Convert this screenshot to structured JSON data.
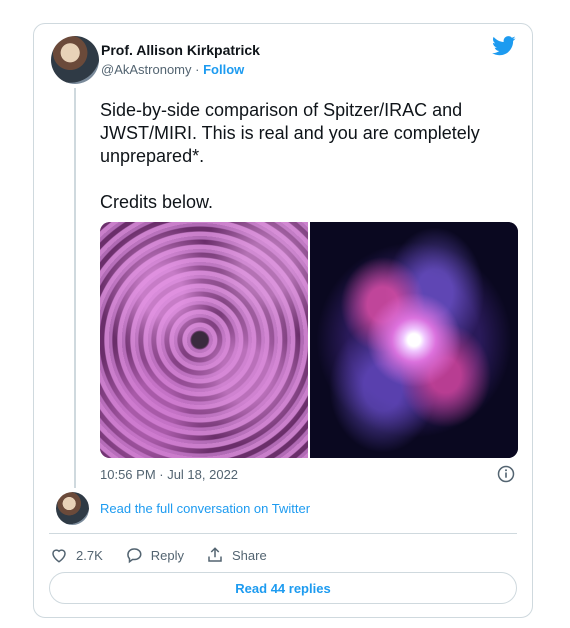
{
  "author": {
    "name": "Prof. Allison Kirkpatrick",
    "handle": "@AkAstronomy",
    "separator": "·",
    "follow_label": "Follow"
  },
  "tweet": {
    "text": "Side-by-side comparison of Spitzer/IRAC and JWST/MIRI. This is real and you are completely unprepared*.\n\nCredits below.",
    "timestamp": "10:56 PM · Jul 18, 2022"
  },
  "media": {
    "left_image": "jwst-miri-galaxy-image",
    "right_image": "spitzer-irac-galaxy-image"
  },
  "conversation_link": "Read the full conversation on Twitter",
  "actions": {
    "likes_count": "2.7K",
    "reply_label": "Reply",
    "share_label": "Share"
  },
  "read_replies_label": "Read 44 replies",
  "icons": {
    "brand": "twitter-bird-icon",
    "info": "info-icon",
    "like": "heart-icon",
    "reply": "reply-bubble-icon",
    "share": "share-icon"
  },
  "colors": {
    "accent": "#1d9bf0",
    "text": "#0f1419",
    "muted": "#536471",
    "border": "#cfd9de"
  }
}
